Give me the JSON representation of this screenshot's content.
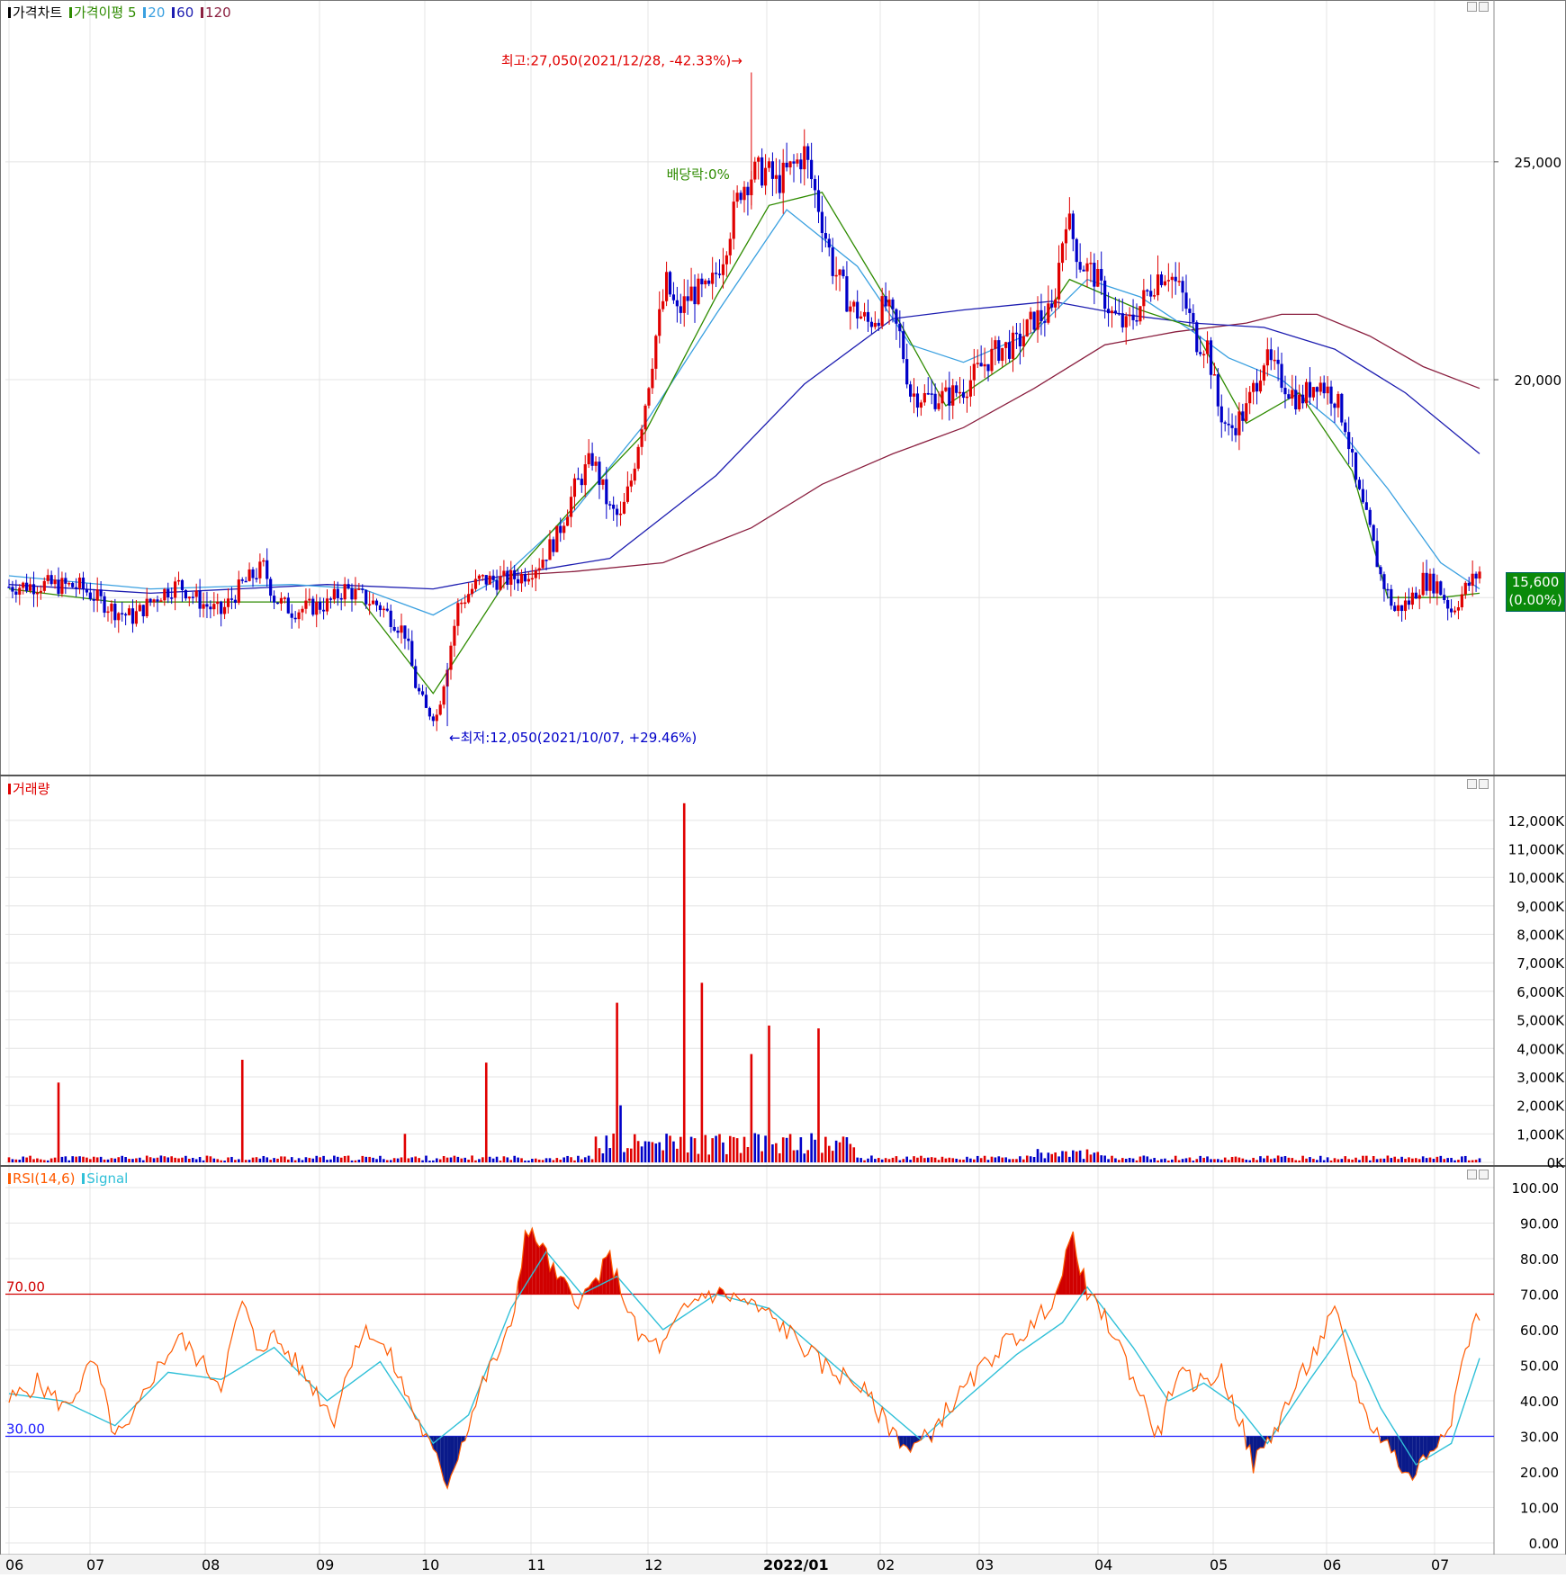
{
  "price_legend": {
    "title": "가격차트",
    "ma_label": "가격이평",
    "ma_items": [
      "5",
      "20",
      "60",
      "120"
    ]
  },
  "volume_legend": {
    "title": "거래량"
  },
  "rsi_legend": {
    "title": "RSI(14,6)",
    "signal": "Signal"
  },
  "annotations": {
    "high": "최고:27,050(2021/12/28, -42.33%)",
    "low": "최저:12,050(2021/10/07, +29.46%)",
    "dividend": "배당락:0%"
  },
  "current_price": {
    "value": "15,600",
    "change": "(0.00%)"
  },
  "rsi_levels": {
    "upper_label": "70.00",
    "lower_label": "30.00"
  },
  "colors": {
    "up": "#e00000",
    "down": "#0000c8",
    "ma5": "#2e8b00",
    "ma20": "#3aa0e0",
    "ma60": "#1c1cb0",
    "ma120": "#8b2040",
    "rsi": "#ff5a00",
    "signal": "#30c0d8",
    "grid": "#e4e4e4",
    "highlight_box": "#0a8a0a"
  },
  "chart_data": [
    {
      "type": "candlestick",
      "title": "가격차트",
      "x_ticks": [
        "06",
        "07",
        "08",
        "09",
        "10",
        "11",
        "12",
        "2022/01",
        "02",
        "03",
        "04",
        "05",
        "06",
        "07"
      ],
      "y_ticks": [
        "25,000",
        "20,000"
      ],
      "ylim": [
        11000,
        28300
      ],
      "grid": true,
      "series_names": [
        "가격이평 5",
        "20",
        "60",
        "120"
      ],
      "highest": {
        "value": 27050,
        "date": "2021/12/28"
      },
      "lowest": {
        "value": 12050,
        "date": "2021/10/07"
      },
      "last": 15600,
      "approx_close_path": [
        [
          0,
          15250
        ],
        [
          10,
          15300
        ],
        [
          20,
          15250
        ],
        [
          30,
          14700
        ],
        [
          35,
          14550
        ],
        [
          43,
          15100
        ],
        [
          48,
          15300
        ],
        [
          55,
          14850
        ],
        [
          60,
          14650
        ],
        [
          66,
          15300
        ],
        [
          72,
          15700
        ],
        [
          75,
          15000
        ],
        [
          80,
          14700
        ],
        [
          90,
          14850
        ],
        [
          95,
          15200
        ],
        [
          100,
          15000
        ],
        [
          105,
          14800
        ],
        [
          112,
          14200
        ],
        [
          115,
          13000
        ],
        [
          118,
          12400
        ],
        [
          121,
          12300
        ],
        [
          124,
          13500
        ],
        [
          127,
          14800
        ],
        [
          133,
          15400
        ],
        [
          140,
          15400
        ],
        [
          145,
          15500
        ],
        [
          150,
          15800
        ],
        [
          155,
          16400
        ],
        [
          160,
          17500
        ],
        [
          165,
          18200
        ],
        [
          170,
          17000
        ],
        [
          173,
          16800
        ],
        [
          176,
          17700
        ],
        [
          180,
          19500
        ],
        [
          183,
          21000
        ],
        [
          186,
          22200
        ],
        [
          189,
          21500
        ],
        [
          193,
          22000
        ],
        [
          198,
          22000
        ],
        [
          202,
          22900
        ],
        [
          207,
          24400
        ],
        [
          210,
          24700
        ],
        [
          214,
          24800
        ],
        [
          217,
          24500
        ],
        [
          222,
          24900
        ],
        [
          225,
          25200
        ],
        [
          229,
          24000
        ],
        [
          233,
          22600
        ],
        [
          238,
          21700
        ],
        [
          243,
          21300
        ],
        [
          248,
          21700
        ],
        [
          252,
          21000
        ],
        [
          255,
          19700
        ],
        [
          259,
          19600
        ],
        [
          265,
          19600
        ],
        [
          270,
          19800
        ],
        [
          275,
          20300
        ],
        [
          280,
          20700
        ],
        [
          285,
          20800
        ],
        [
          290,
          21400
        ],
        [
          295,
          21500
        ],
        [
          299,
          23800
        ],
        [
          303,
          22700
        ],
        [
          307,
          22400
        ],
        [
          312,
          21500
        ],
        [
          316,
          21200
        ],
        [
          320,
          21700
        ],
        [
          325,
          22400
        ],
        [
          328,
          22500
        ],
        [
          332,
          21900
        ],
        [
          336,
          20900
        ],
        [
          339,
          20800
        ],
        [
          342,
          19400
        ],
        [
          345,
          18800
        ],
        [
          350,
          19300
        ],
        [
          355,
          20500
        ],
        [
          360,
          20000
        ],
        [
          365,
          19500
        ],
        [
          370,
          20000
        ],
        [
          375,
          19600
        ],
        [
          378,
          19000
        ],
        [
          381,
          17600
        ],
        [
          385,
          16500
        ],
        [
          388,
          15500
        ],
        [
          392,
          14700
        ],
        [
          396,
          14900
        ],
        [
          400,
          15400
        ],
        [
          404,
          15300
        ],
        [
          408,
          14700
        ],
        [
          412,
          15200
        ],
        [
          416,
          15600
        ]
      ],
      "ma_lines": {
        "ma5": [
          [
            0,
            15200
          ],
          [
            30,
            14900
          ],
          [
            60,
            14900
          ],
          [
            100,
            14900
          ],
          [
            120,
            12800
          ],
          [
            140,
            15300
          ],
          [
            160,
            17100
          ],
          [
            180,
            18800
          ],
          [
            200,
            21900
          ],
          [
            215,
            24000
          ],
          [
            230,
            24300
          ],
          [
            250,
            21600
          ],
          [
            265,
            19400
          ],
          [
            285,
            20500
          ],
          [
            300,
            22300
          ],
          [
            320,
            21600
          ],
          [
            335,
            21200
          ],
          [
            350,
            19000
          ],
          [
            365,
            19700
          ],
          [
            380,
            17900
          ],
          [
            390,
            15000
          ],
          [
            405,
            15000
          ],
          [
            416,
            15100
          ]
        ],
        "ma20": [
          [
            0,
            15500
          ],
          [
            40,
            15200
          ],
          [
            80,
            15300
          ],
          [
            100,
            15200
          ],
          [
            120,
            14600
          ],
          [
            140,
            15500
          ],
          [
            160,
            17000
          ],
          [
            180,
            19000
          ],
          [
            200,
            21500
          ],
          [
            220,
            23900
          ],
          [
            240,
            22600
          ],
          [
            255,
            20800
          ],
          [
            270,
            20400
          ],
          [
            290,
            21100
          ],
          [
            305,
            22300
          ],
          [
            320,
            21900
          ],
          [
            335,
            21100
          ],
          [
            345,
            20500
          ],
          [
            360,
            20000
          ],
          [
            375,
            19000
          ],
          [
            390,
            17500
          ],
          [
            405,
            15800
          ],
          [
            416,
            15200
          ]
        ],
        "ma60": [
          [
            0,
            15300
          ],
          [
            40,
            15100
          ],
          [
            90,
            15300
          ],
          [
            120,
            15200
          ],
          [
            140,
            15500
          ],
          [
            170,
            15900
          ],
          [
            200,
            17800
          ],
          [
            225,
            19900
          ],
          [
            250,
            21400
          ],
          [
            270,
            21600
          ],
          [
            295,
            21800
          ],
          [
            315,
            21500
          ],
          [
            335,
            21300
          ],
          [
            355,
            21200
          ],
          [
            375,
            20700
          ],
          [
            395,
            19700
          ],
          [
            416,
            18300
          ]
        ],
        "ma120": [
          [
            140,
            15500
          ],
          [
            160,
            15600
          ],
          [
            185,
            15800
          ],
          [
            210,
            16600
          ],
          [
            230,
            17600
          ],
          [
            250,
            18300
          ],
          [
            270,
            18900
          ],
          [
            290,
            19800
          ],
          [
            310,
            20800
          ],
          [
            330,
            21100
          ],
          [
            350,
            21300
          ],
          [
            360,
            21500
          ],
          [
            370,
            21500
          ],
          [
            385,
            21000
          ],
          [
            400,
            20300
          ],
          [
            416,
            19800
          ]
        ]
      }
    },
    {
      "type": "bar",
      "title": "거래량",
      "y_ticks": [
        "12,000K",
        "11,000K",
        "10,000K",
        "9,000K",
        "8,000K",
        "7,000K",
        "6,000K",
        "5,000K",
        "4,000K",
        "3,000K",
        "2,000K",
        "1,000K",
        "0K"
      ],
      "ylim": [
        0,
        12500
      ],
      "unit": "K",
      "notable_bars": [
        {
          "x": 14,
          "value": 2800,
          "dir": "up"
        },
        {
          "x": 66,
          "value": 3600,
          "dir": "up"
        },
        {
          "x": 112,
          "value": 1000,
          "dir": "up"
        },
        {
          "x": 135,
          "value": 3500,
          "dir": "up"
        },
        {
          "x": 172,
          "value": 5600,
          "dir": "up"
        },
        {
          "x": 173,
          "value": 2000,
          "dir": "down"
        },
        {
          "x": 191,
          "value": 12600,
          "dir": "up"
        },
        {
          "x": 196,
          "value": 6300,
          "dir": "up"
        },
        {
          "x": 210,
          "value": 3800,
          "dir": "up"
        },
        {
          "x": 215,
          "value": 4800,
          "dir": "up"
        },
        {
          "x": 229,
          "value": 4700,
          "dir": "up"
        }
      ]
    },
    {
      "type": "line",
      "title": "RSI(14,6)",
      "series_names": [
        "RSI(14,6)",
        "Signal"
      ],
      "y_ticks": [
        "100.00",
        "90.00",
        "80.00",
        "70.00",
        "60.00",
        "50.00",
        "40.00",
        "30.00",
        "20.00",
        "10.00",
        "0.00"
      ],
      "ylim": [
        0,
        100
      ],
      "levels": [
        70,
        30
      ],
      "rsi": [
        [
          0,
          40
        ],
        [
          8,
          45
        ],
        [
          16,
          38
        ],
        [
          24,
          51
        ],
        [
          30,
          30
        ],
        [
          34,
          32
        ],
        [
          40,
          46
        ],
        [
          48,
          58
        ],
        [
          55,
          50
        ],
        [
          60,
          45
        ],
        [
          66,
          68
        ],
        [
          70,
          55
        ],
        [
          75,
          58
        ],
        [
          80,
          52
        ],
        [
          86,
          44
        ],
        [
          92,
          35
        ],
        [
          98,
          56
        ],
        [
          102,
          60
        ],
        [
          108,
          52
        ],
        [
          114,
          38
        ],
        [
          120,
          25
        ],
        [
          124,
          17
        ],
        [
          128,
          28
        ],
        [
          134,
          45
        ],
        [
          142,
          60
        ],
        [
          146,
          87
        ],
        [
          150,
          85
        ],
        [
          155,
          74
        ],
        [
          162,
          68
        ],
        [
          170,
          80
        ],
        [
          178,
          58
        ],
        [
          185,
          55
        ],
        [
          190,
          64
        ],
        [
          196,
          70
        ],
        [
          202,
          70
        ],
        [
          208,
          68
        ],
        [
          215,
          64
        ],
        [
          222,
          58
        ],
        [
          230,
          50
        ],
        [
          240,
          45
        ],
        [
          248,
          34
        ],
        [
          255,
          26
        ],
        [
          260,
          30
        ],
        [
          265,
          37
        ],
        [
          272,
          45
        ],
        [
          280,
          55
        ],
        [
          290,
          61
        ],
        [
          297,
          72
        ],
        [
          301,
          87
        ],
        [
          305,
          70
        ],
        [
          312,
          60
        ],
        [
          320,
          42
        ],
        [
          325,
          30
        ],
        [
          330,
          47
        ],
        [
          337,
          45
        ],
        [
          343,
          48
        ],
        [
          348,
          35
        ],
        [
          352,
          22
        ],
        [
          357,
          30
        ],
        [
          362,
          40
        ],
        [
          370,
          55
        ],
        [
          375,
          65
        ],
        [
          380,
          48
        ],
        [
          384,
          35
        ],
        [
          390,
          28
        ],
        [
          396,
          18
        ],
        [
          402,
          26
        ],
        [
          408,
          36
        ],
        [
          412,
          55
        ],
        [
          416,
          65
        ]
      ],
      "signal": [
        [
          0,
          42
        ],
        [
          15,
          40
        ],
        [
          30,
          33
        ],
        [
          45,
          48
        ],
        [
          60,
          46
        ],
        [
          75,
          55
        ],
        [
          90,
          40
        ],
        [
          105,
          51
        ],
        [
          120,
          28
        ],
        [
          130,
          36
        ],
        [
          142,
          66
        ],
        [
          152,
          82
        ],
        [
          162,
          70
        ],
        [
          172,
          75
        ],
        [
          185,
          60
        ],
        [
          200,
          70
        ],
        [
          215,
          66
        ],
        [
          230,
          53
        ],
        [
          245,
          40
        ],
        [
          258,
          29
        ],
        [
          270,
          40
        ],
        [
          285,
          53
        ],
        [
          298,
          62
        ],
        [
          305,
          72
        ],
        [
          318,
          55
        ],
        [
          328,
          40
        ],
        [
          338,
          45
        ],
        [
          348,
          38
        ],
        [
          356,
          28
        ],
        [
          368,
          46
        ],
        [
          378,
          60
        ],
        [
          388,
          38
        ],
        [
          398,
          22
        ],
        [
          408,
          28
        ],
        [
          416,
          52
        ]
      ]
    }
  ]
}
